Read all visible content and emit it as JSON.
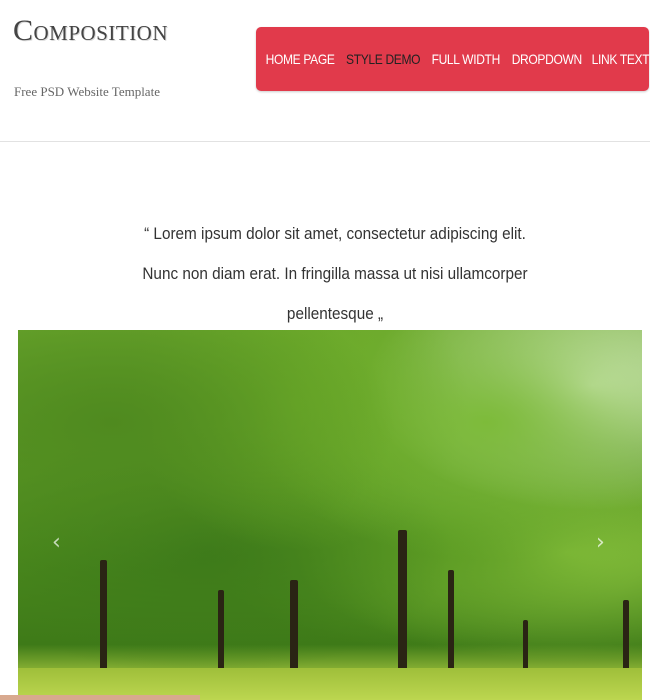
{
  "site": {
    "logo_text": "Composition",
    "tagline": "Free PSD Website Template"
  },
  "nav": {
    "items": [
      {
        "label": "HOME PAGE",
        "active": false
      },
      {
        "label": "STYLE DEMO",
        "active": true
      },
      {
        "label": "FULL WIDTH",
        "active": false
      },
      {
        "label": "DROPDOWN",
        "active": false
      },
      {
        "label": "LINK TEXT",
        "active": false
      }
    ],
    "color": "#e13a4b"
  },
  "quote": {
    "text": "“ Lorem ipsum dolor sit amet, consectetur adipiscing elit. Nunc non diam erat. In fringilla massa ut nisi ullamcorper pellentesque „"
  },
  "slider": {
    "prev_icon": "chevron-left-icon",
    "next_icon": "chevron-right-icon",
    "prev_glyph": "‹",
    "next_glyph": "›"
  }
}
